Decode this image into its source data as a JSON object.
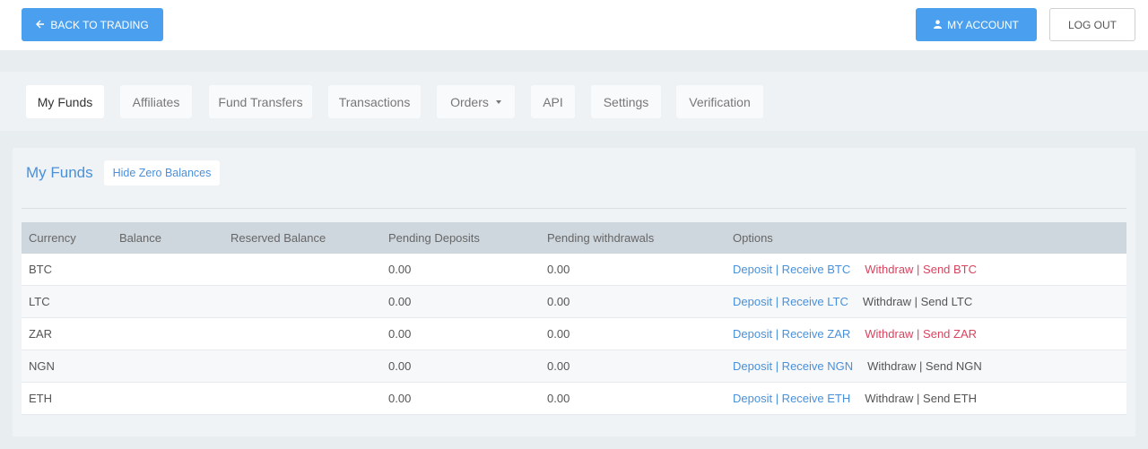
{
  "header": {
    "back_label": "BACK TO TRADING",
    "account_label": "MY ACCOUNT",
    "logout_label": "LOG OUT"
  },
  "tabs": [
    {
      "label": "My Funds"
    },
    {
      "label": "Affiliates"
    },
    {
      "label": "Fund Transfers"
    },
    {
      "label": "Transactions"
    },
    {
      "label": "Orders"
    },
    {
      "label": "API"
    },
    {
      "label": "Settings"
    },
    {
      "label": "Verification"
    }
  ],
  "panel": {
    "title": "My Funds",
    "hide_zero_label": "Hide Zero Balances"
  },
  "table": {
    "headers": [
      "Currency",
      "Balance",
      "Reserved Balance",
      "Pending Deposits",
      "Pending withdrawals",
      "Options"
    ],
    "rows": [
      {
        "currency": "BTC",
        "balance": "",
        "reserved": "",
        "pending_dep": "0.00",
        "pending_wd": "0.00",
        "deposit": "Deposit | Receive BTC",
        "withdraw": "Withdraw | Send BTC",
        "withdraw_color": "#d9435e"
      },
      {
        "currency": "LTC",
        "balance": "",
        "reserved": "",
        "pending_dep": "0.00",
        "pending_wd": "0.00",
        "deposit": "Deposit | Receive LTC",
        "withdraw": "Withdraw | Send LTC",
        "withdraw_color": "#555555"
      },
      {
        "currency": "ZAR",
        "balance": "",
        "reserved": "",
        "pending_dep": "0.00",
        "pending_wd": "0.00",
        "deposit": "Deposit | Receive ZAR",
        "withdraw": "Withdraw | Send ZAR",
        "withdraw_color": "#d9435e"
      },
      {
        "currency": "NGN",
        "balance": "",
        "reserved": "",
        "pending_dep": "0.00",
        "pending_wd": "0.00",
        "deposit": "Deposit | Receive NGN",
        "withdraw": "Withdraw | Send NGN",
        "withdraw_color": "#555555"
      },
      {
        "currency": "ETH",
        "balance": "",
        "reserved": "",
        "pending_dep": "0.00",
        "pending_wd": "0.00",
        "deposit": "Deposit | Receive ETH",
        "withdraw": "Withdraw | Send ETH",
        "withdraw_color": "#555555"
      }
    ]
  },
  "colors": {
    "accent": "#4aa0ee",
    "link": "#4a90d9",
    "withdraw_active": "#d9435e"
  },
  "icons": {
    "back": "arrow-left-icon",
    "account": "user-icon",
    "orders": "caret-down-icon"
  }
}
